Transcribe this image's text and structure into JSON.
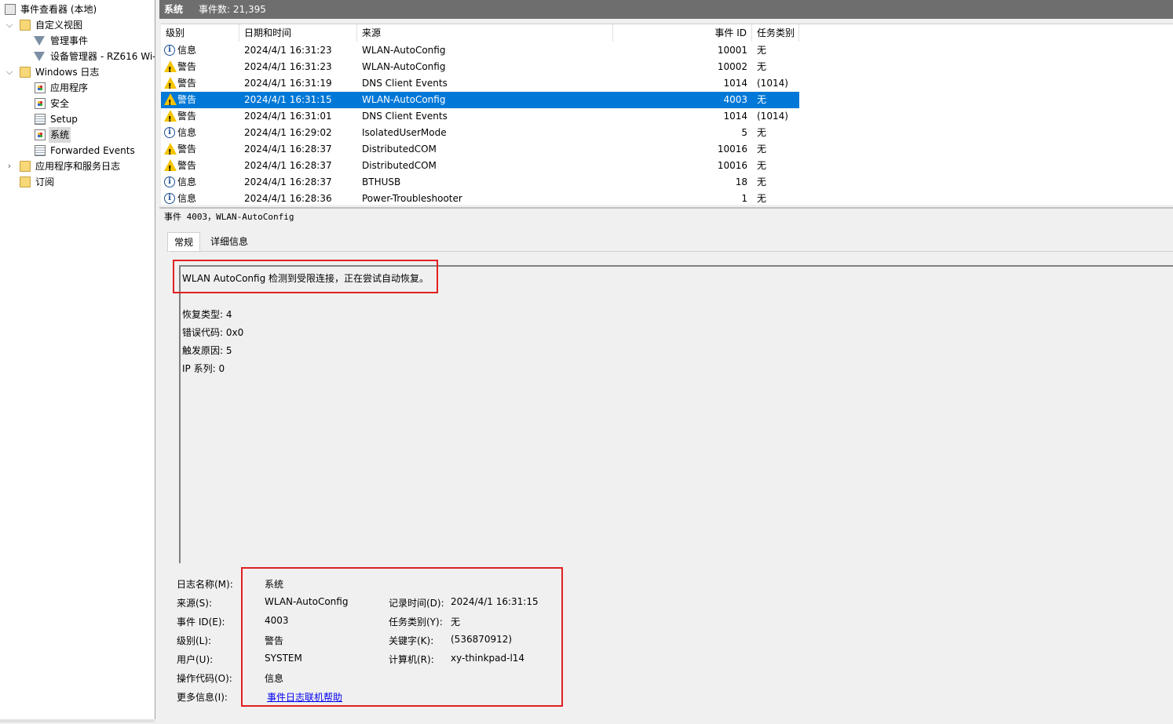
{
  "tree": {
    "root": "事件查看器 (本地)",
    "custom_views": "自定义视图",
    "admin_events": "管理事件",
    "device_manager": "设备管理器 - RZ616 Wi-",
    "windows_logs": "Windows 日志",
    "application": "应用程序",
    "security": "安全",
    "setup": "Setup",
    "system": "系统",
    "forwarded": "Forwarded Events",
    "app_service_logs": "应用程序和服务日志",
    "subscriptions": "订阅"
  },
  "titlebar": {
    "name": "系统",
    "count": "事件数: 21,395"
  },
  "columns": {
    "level": "级别",
    "datetime": "日期和时间",
    "source": "来源",
    "event_id": "事件 ID",
    "task": "任务类别"
  },
  "events": [
    {
      "level_icon": "info-icon",
      "level": "信息",
      "datetime": "2024/4/1 16:31:23",
      "source": "WLAN-AutoConfig",
      "event_id": "10001",
      "task": "无"
    },
    {
      "level_icon": "warning-icon",
      "level": "警告",
      "datetime": "2024/4/1 16:31:23",
      "source": "WLAN-AutoConfig",
      "event_id": "10002",
      "task": "无"
    },
    {
      "level_icon": "warning-icon",
      "level": "警告",
      "datetime": "2024/4/1 16:31:19",
      "source": "DNS Client Events",
      "event_id": "1014",
      "task": "(1014)"
    },
    {
      "level_icon": "warning-icon",
      "level": "警告",
      "datetime": "2024/4/1 16:31:15",
      "source": "WLAN-AutoConfig",
      "event_id": "4003",
      "task": "无"
    },
    {
      "level_icon": "warning-icon",
      "level": "警告",
      "datetime": "2024/4/1 16:31:01",
      "source": "DNS Client Events",
      "event_id": "1014",
      "task": "(1014)"
    },
    {
      "level_icon": "info-icon",
      "level": "信息",
      "datetime": "2024/4/1 16:29:02",
      "source": "IsolatedUserMode",
      "event_id": "5",
      "task": "无"
    },
    {
      "level_icon": "warning-icon",
      "level": "警告",
      "datetime": "2024/4/1 16:28:37",
      "source": "DistributedCOM",
      "event_id": "10016",
      "task": "无"
    },
    {
      "level_icon": "warning-icon",
      "level": "警告",
      "datetime": "2024/4/1 16:28:37",
      "source": "DistributedCOM",
      "event_id": "10016",
      "task": "无"
    },
    {
      "level_icon": "info-icon",
      "level": "信息",
      "datetime": "2024/4/1 16:28:37",
      "source": "BTHUSB",
      "event_id": "18",
      "task": "无"
    },
    {
      "level_icon": "info-icon",
      "level": "信息",
      "datetime": "2024/4/1 16:28:36",
      "source": "Power-Troubleshooter",
      "event_id": "1",
      "task": "无"
    }
  ],
  "detail": {
    "title": "事件 4003，WLAN-AutoConfig",
    "tab_general": "常规",
    "tab_details": "详细信息",
    "description": "WLAN AutoConfig 检测到受限连接，正在尝试自动恢复。",
    "recovery_type": "恢复类型: 4",
    "error_code": "错误代码: 0x0",
    "trigger_reason": "触发原因: 5",
    "ip_family": "IP 系列: 0",
    "labels": {
      "log_name": "日志名称(M):",
      "source": "来源(S):",
      "event_id": "事件 ID(E):",
      "level": "级别(L):",
      "user": "用户(U):",
      "opcode": "操作代码(O):",
      "more_info": "更多信息(I):",
      "logged": "记录时间(D):",
      "task": "任务类别(Y):",
      "keywords": "关键字(K):",
      "computer": "计算机(R):"
    },
    "values": {
      "log_name": "系统",
      "source": "WLAN-AutoConfig",
      "event_id": "4003",
      "level": "警告",
      "user": "SYSTEM",
      "opcode": "信息",
      "more_info": "事件日志联机帮助",
      "logged": "2024/4/1 16:31:15",
      "task": "无",
      "keywords": "(536870912)",
      "computer": "xy-thinkpad-l14"
    }
  },
  "colors": {
    "selection": "#0078d7",
    "highlight_box": "#e02020",
    "titlebar": "#6e6e6e"
  }
}
